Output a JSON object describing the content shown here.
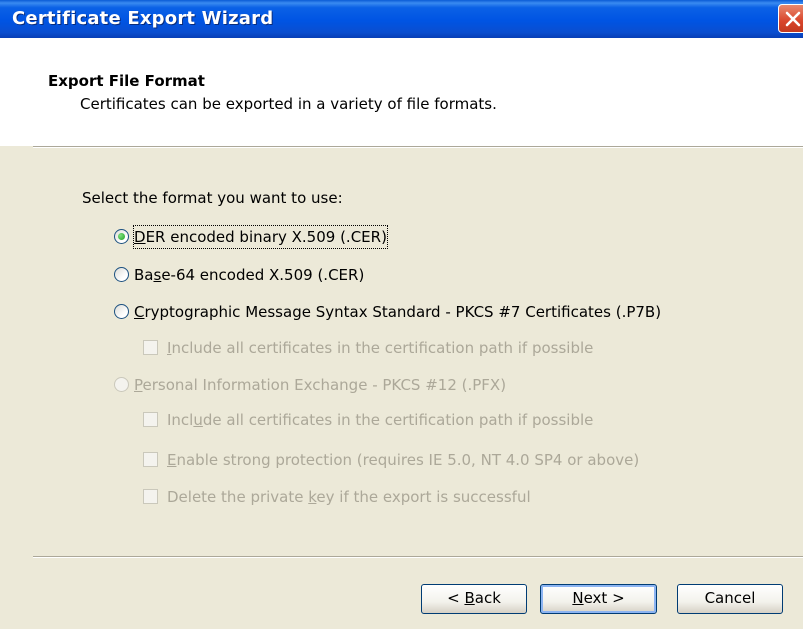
{
  "window": {
    "title": "Certificate Export Wizard"
  },
  "header": {
    "title": "Export File Format",
    "subtitle": "Certificates can be exported in a variety of file formats."
  },
  "main": {
    "prompt": "Select the format you want to use:",
    "options": [
      {
        "pre": "",
        "key": "D",
        "post": "ER encoded binary X.509 (.CER)",
        "selected": true,
        "enabled": true
      },
      {
        "pre": "Ba",
        "key": "s",
        "post": "e-64 encoded X.509 (.CER)",
        "selected": false,
        "enabled": true
      },
      {
        "pre": "",
        "key": "C",
        "post": "ryptographic Message Syntax Standard - PKCS #7 Certificates (.P7B)",
        "selected": false,
        "enabled": true
      },
      {
        "pre": "",
        "key": "P",
        "post": "ersonal Information Exchange - PKCS #12 (.PFX)",
        "selected": false,
        "enabled": false
      }
    ],
    "pkcs7_checkbox": {
      "pre": "",
      "key": "I",
      "post": "nclude all certificates in the certification path if possible",
      "checked": false,
      "enabled": false
    },
    "pfx_checkboxes": [
      {
        "pre": "Incl",
        "key": "u",
        "post": "de all certificates in the certification path if possible",
        "checked": false,
        "enabled": false
      },
      {
        "pre": "",
        "key": "E",
        "post": "nable strong protection (requires IE 5.0, NT 4.0 SP4 or above)",
        "checked": false,
        "enabled": false
      },
      {
        "pre": "Delete the private ",
        "key": "k",
        "post": "ey if the export is successful",
        "checked": false,
        "enabled": false
      }
    ]
  },
  "buttons": {
    "back": {
      "pre": "< ",
      "key": "B",
      "post": "ack"
    },
    "next": {
      "pre": "",
      "key": "N",
      "post": "ext >"
    },
    "cancel": "Cancel"
  },
  "colors": {
    "titlebar": "#0054E3",
    "window_bg": "#ECE9D8",
    "close_button": "#D9452B",
    "radio_selected": "#21A121",
    "disabled_text": "#ACA899"
  }
}
